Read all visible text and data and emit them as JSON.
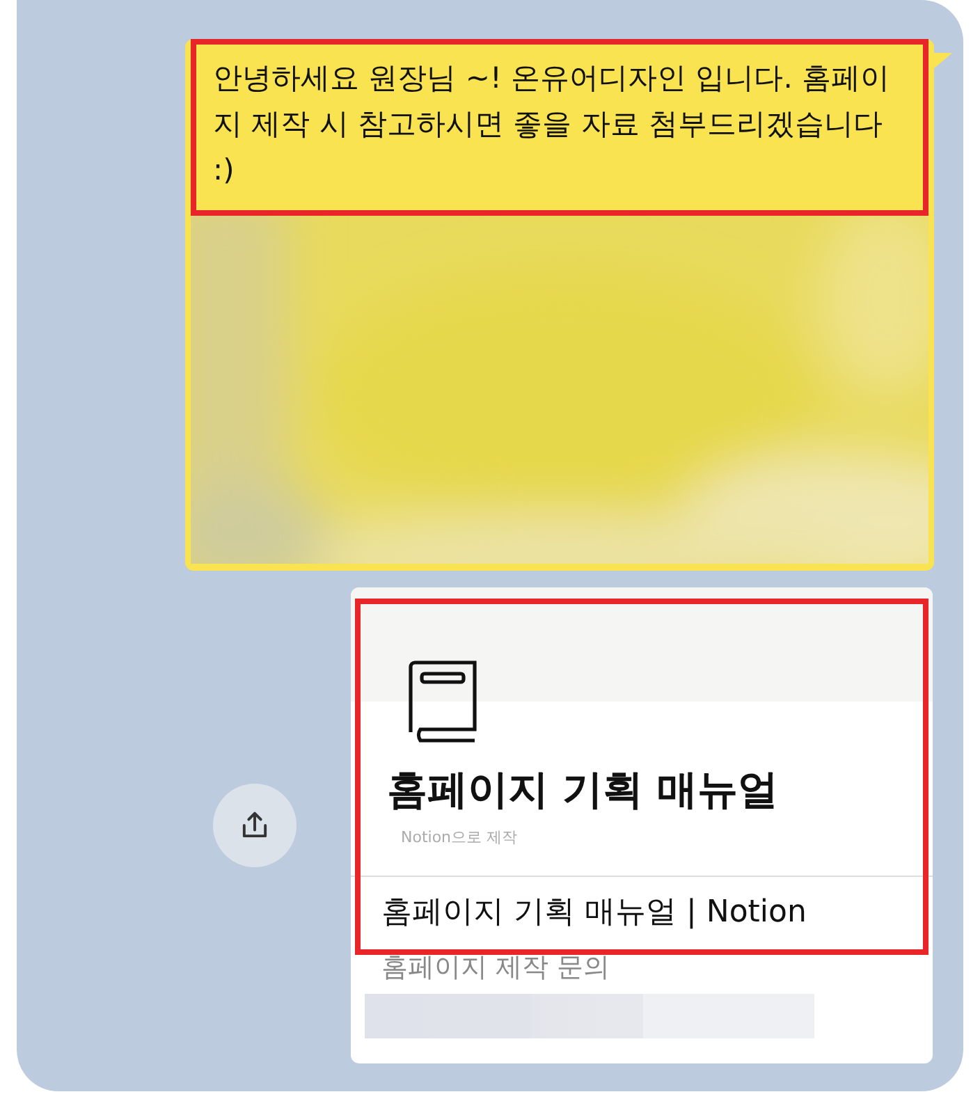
{
  "message": {
    "text": "안녕하세요 원장님 ~! 온유어디자인 입니다. 홈페이지 제작 시 참고하시면 좋을 자료 첨부드리겠습니다 :)",
    "highlighted": true
  },
  "link_card": {
    "title": "홈페이지 기획 매뉴얼",
    "subtitle": "Notion으로 제작",
    "page_title": "홈페이지 기획 매뉴얼 | Notion",
    "description": "홈페이지 제작 문의",
    "highlighted": true
  }
}
